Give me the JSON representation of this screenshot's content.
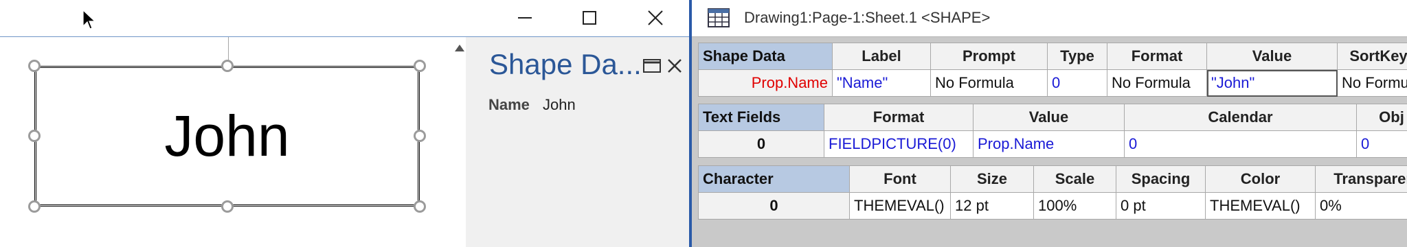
{
  "left_window": {
    "shape_text": "John",
    "shape_data_pane": {
      "title": "Shape Da...",
      "rows": [
        {
          "label": "Name",
          "value": "John"
        }
      ]
    }
  },
  "shapesheet": {
    "title": "Drawing1:Page-1:Sheet.1 <SHAPE>",
    "shape_data": {
      "section": "Shape Data",
      "headers": [
        "Label",
        "Prompt",
        "Type",
        "Format",
        "Value",
        "SortKey"
      ],
      "rows": [
        {
          "name": "Prop.Name",
          "cells": [
            "\"Name\"",
            "No Formula",
            "0",
            "No Formula",
            "\"John\"",
            "No Formu"
          ]
        }
      ]
    },
    "text_fields": {
      "section": "Text Fields",
      "headers": [
        "Format",
        "Value",
        "Calendar",
        "Obj"
      ],
      "rows": [
        {
          "name": "0",
          "cells": [
            "FIELDPICTURE(0)",
            "Prop.Name",
            "0",
            "0"
          ]
        }
      ]
    },
    "character": {
      "section": "Character",
      "headers": [
        "Font",
        "Size",
        "Scale",
        "Spacing",
        "Color",
        "Transparen"
      ],
      "rows": [
        {
          "name": "0",
          "cells": [
            "THEMEVAL()",
            "12 pt",
            "100%",
            "0 pt",
            "THEMEVAL()",
            "0%"
          ]
        }
      ]
    }
  },
  "icons": {
    "cursor": "mouse-pointer-icon",
    "minimize": "minimize-icon",
    "maximize": "maximize-icon",
    "close": "close-icon",
    "scroll_up": "scroll-up-arrow-icon",
    "pane_restore": "restore-icon",
    "pane_close": "close-icon",
    "shapesheet": "shapesheet-icon"
  },
  "colors": {
    "accent_blue": "#2b5797",
    "section_header": "#b7c9e2",
    "divider": "#2a5aa8",
    "formula_blue": "#1a1ad6",
    "row_name_red": "#e00000"
  }
}
